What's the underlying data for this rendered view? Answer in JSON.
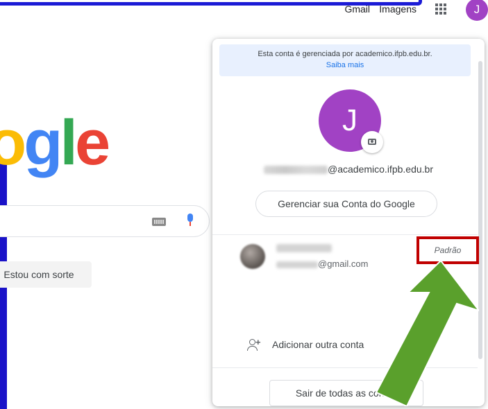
{
  "topbar": {
    "gmail": "Gmail",
    "images": "Imagens",
    "apps_icon": "apps-grid-icon",
    "avatar_letter": "J"
  },
  "logo": {
    "partial_text": "ogle"
  },
  "search": {
    "keyboard_icon": "keyboard-icon",
    "mic_icon": "mic-icon"
  },
  "buttons": {
    "lucky": "Estou com sorte"
  },
  "account_menu": {
    "managed_notice": "Esta conta é gerenciada por academico.ifpb.edu.br.",
    "learn_more": "Saiba mais",
    "avatar_letter": "J",
    "email_domain": "@academico.ifpb.edu.br",
    "manage_button": "Gerenciar sua Conta do Google",
    "other_account": {
      "email_domain": "@gmail.com",
      "badge": "Padrão"
    },
    "add_account": "Adicionar outra conta",
    "sign_out_all": "Sair de todas as contas"
  },
  "colors": {
    "avatar": "#a142c4",
    "highlight_box": "#c00000",
    "arrow": "#5aa02c",
    "annotation_blue": "#1b1bd6"
  }
}
